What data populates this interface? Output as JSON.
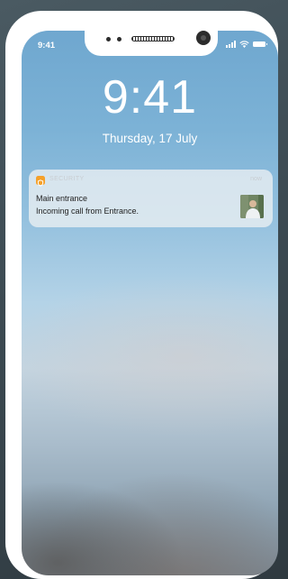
{
  "status_bar": {
    "time": "9:41",
    "icons": [
      "signal-icon",
      "wifi-icon",
      "battery-icon"
    ]
  },
  "lock_screen": {
    "time": "9:41",
    "date": "Thursday, 17 July"
  },
  "notification": {
    "app_name": "SECURITY",
    "time": "now",
    "title": "Main entrance",
    "body": "Incoming call from Entrance.",
    "app_icon": "shield-icon",
    "accent_color": "#f5a12b"
  },
  "colors": {
    "frame": "#ffffff",
    "background": "#3c4a52",
    "sky_top": "#6fa7cf"
  }
}
